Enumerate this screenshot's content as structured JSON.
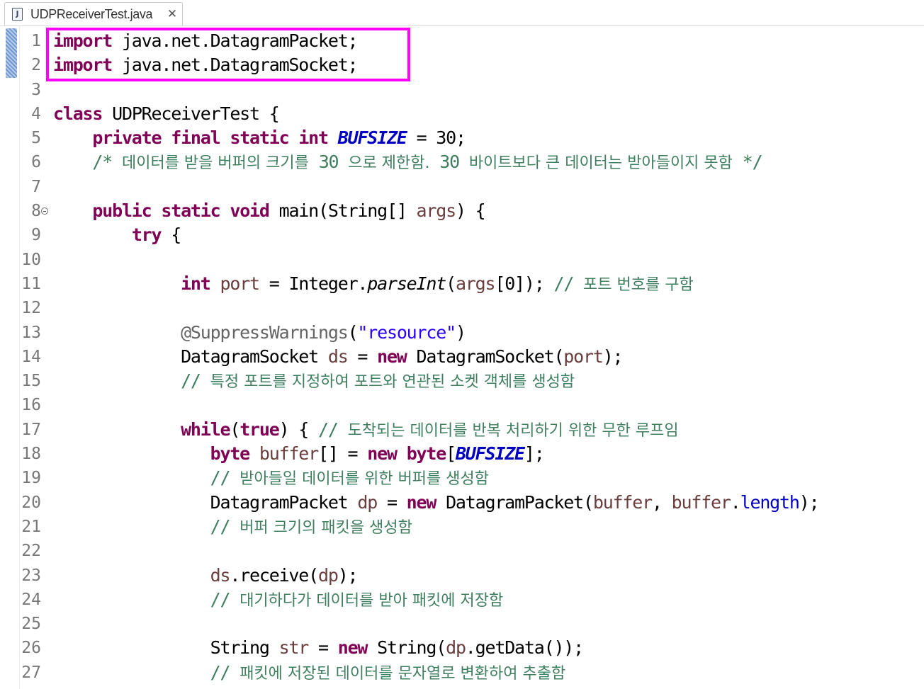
{
  "tab": {
    "filename": "UDPReceiverTest.java",
    "file_icon": "java-file-icon",
    "file_icon_glyph": "J",
    "close_glyph": "✕",
    "close_icon": "close-icon"
  },
  "colors": {
    "keyword": "#7f0055",
    "comment": "#3f7f5f",
    "constant": "#0000c0",
    "string": "#2a00ff",
    "annotation": "#646464",
    "local_variable": "#6a3e3e",
    "highlight_box": "#ff00ff"
  },
  "lines": [
    {
      "num": "1",
      "segments": [
        {
          "text": "import",
          "cls": "kw"
        },
        {
          "text": " java.net.DatagramPacket;"
        }
      ]
    },
    {
      "num": "2",
      "segments": [
        {
          "text": "import",
          "cls": "kw"
        },
        {
          "text": " java.net.DatagramSocket;"
        }
      ]
    },
    {
      "num": "3",
      "segments": []
    },
    {
      "num": "4",
      "segments": [
        {
          "text": "class",
          "cls": "kw"
        },
        {
          "text": " UDPReceiverTest {"
        }
      ]
    },
    {
      "num": "5",
      "segments": [
        {
          "text": "    "
        },
        {
          "text": "private",
          "cls": "kw"
        },
        {
          "text": " "
        },
        {
          "text": "final",
          "cls": "kw"
        },
        {
          "text": " "
        },
        {
          "text": "static",
          "cls": "kw"
        },
        {
          "text": " "
        },
        {
          "text": "int",
          "cls": "kw"
        },
        {
          "text": " "
        },
        {
          "text": "BUFSIZE",
          "cls": "const"
        },
        {
          "text": " = 30;"
        }
      ]
    },
    {
      "num": "6",
      "segments": [
        {
          "text": "    "
        },
        {
          "text": "/* ",
          "cls": "cm"
        },
        {
          "text": "데이터를 받을 버퍼의 크기를",
          "cls": "cm-k"
        },
        {
          "text": " 30 ",
          "cls": "cm"
        },
        {
          "text": "으로 제한함.",
          "cls": "cm-k"
        },
        {
          "text": " 30 ",
          "cls": "cm"
        },
        {
          "text": "바이트보다 큰 데이터는 받아들이지 못함",
          "cls": "cm-k"
        },
        {
          "text": " */",
          "cls": "cm"
        }
      ]
    },
    {
      "num": "7",
      "segments": []
    },
    {
      "num": "8",
      "fold": true,
      "segments": [
        {
          "text": "    "
        },
        {
          "text": "public",
          "cls": "kw"
        },
        {
          "text": " "
        },
        {
          "text": "static",
          "cls": "kw"
        },
        {
          "text": " "
        },
        {
          "text": "void",
          "cls": "kw"
        },
        {
          "text": " main(String[] "
        },
        {
          "text": "args",
          "cls": "var"
        },
        {
          "text": ") {"
        }
      ]
    },
    {
      "num": "9",
      "segments": [
        {
          "text": "        "
        },
        {
          "text": "try",
          "cls": "kw"
        },
        {
          "text": " {"
        }
      ]
    },
    {
      "num": "10",
      "segments": []
    },
    {
      "num": "11",
      "segments": [
        {
          "text": "             "
        },
        {
          "text": "int",
          "cls": "kw"
        },
        {
          "text": " "
        },
        {
          "text": "port",
          "cls": "var"
        },
        {
          "text": " = Integer."
        },
        {
          "text": "parseInt",
          "cls": "it"
        },
        {
          "text": "("
        },
        {
          "text": "args",
          "cls": "var"
        },
        {
          "text": "[0]); "
        },
        {
          "text": "// ",
          "cls": "cm"
        },
        {
          "text": "포트 번호를 구함",
          "cls": "cm-k"
        }
      ]
    },
    {
      "num": "12",
      "segments": []
    },
    {
      "num": "13",
      "segments": [
        {
          "text": "             "
        },
        {
          "text": "@SuppressWarnings",
          "cls": "ann"
        },
        {
          "text": "("
        },
        {
          "text": "\"resource\"",
          "cls": "str"
        },
        {
          "text": ")"
        }
      ]
    },
    {
      "num": "14",
      "segments": [
        {
          "text": "             DatagramSocket "
        },
        {
          "text": "ds",
          "cls": "var"
        },
        {
          "text": " = "
        },
        {
          "text": "new",
          "cls": "kw"
        },
        {
          "text": " DatagramSocket("
        },
        {
          "text": "port",
          "cls": "var"
        },
        {
          "text": ");"
        }
      ]
    },
    {
      "num": "15",
      "segments": [
        {
          "text": "             "
        },
        {
          "text": "// ",
          "cls": "cm"
        },
        {
          "text": "특정 포트를 지정하여 포트와 연관된 소켓 객체를 생성함",
          "cls": "cm-k"
        }
      ]
    },
    {
      "num": "16",
      "segments": []
    },
    {
      "num": "17",
      "segments": [
        {
          "text": "             "
        },
        {
          "text": "while",
          "cls": "kw"
        },
        {
          "text": "("
        },
        {
          "text": "true",
          "cls": "kw"
        },
        {
          "text": ") { "
        },
        {
          "text": "// ",
          "cls": "cm"
        },
        {
          "text": "도착되는 데이터를 반복 처리하기 위한 무한 루프임",
          "cls": "cm-k"
        }
      ]
    },
    {
      "num": "18",
      "segments": [
        {
          "text": "                "
        },
        {
          "text": "byte",
          "cls": "kw"
        },
        {
          "text": " "
        },
        {
          "text": "buffer",
          "cls": "var"
        },
        {
          "text": "[] = "
        },
        {
          "text": "new",
          "cls": "kw"
        },
        {
          "text": " "
        },
        {
          "text": "byte",
          "cls": "kw"
        },
        {
          "text": "["
        },
        {
          "text": "BUFSIZE",
          "cls": "const"
        },
        {
          "text": "];"
        }
      ]
    },
    {
      "num": "19",
      "segments": [
        {
          "text": "                "
        },
        {
          "text": "// ",
          "cls": "cm"
        },
        {
          "text": "받아들일 데이터를 위한 버퍼를 생성함",
          "cls": "cm-k"
        }
      ]
    },
    {
      "num": "20",
      "segments": [
        {
          "text": "                DatagramPacket "
        },
        {
          "text": "dp",
          "cls": "var"
        },
        {
          "text": " = "
        },
        {
          "text": "new",
          "cls": "kw"
        },
        {
          "text": " DatagramPacket("
        },
        {
          "text": "buffer",
          "cls": "var"
        },
        {
          "text": ", "
        },
        {
          "text": "buffer",
          "cls": "var"
        },
        {
          "text": "."
        },
        {
          "text": "length",
          "cls": "fld"
        },
        {
          "text": ");"
        }
      ]
    },
    {
      "num": "21",
      "segments": [
        {
          "text": "                "
        },
        {
          "text": "// ",
          "cls": "cm"
        },
        {
          "text": "버퍼 크기의 패킷을 생성함",
          "cls": "cm-k"
        }
      ]
    },
    {
      "num": "22",
      "segments": []
    },
    {
      "num": "23",
      "segments": [
        {
          "text": "                "
        },
        {
          "text": "ds",
          "cls": "var"
        },
        {
          "text": ".receive("
        },
        {
          "text": "dp",
          "cls": "var"
        },
        {
          "text": ");"
        }
      ]
    },
    {
      "num": "24",
      "segments": [
        {
          "text": "                "
        },
        {
          "text": "// ",
          "cls": "cm"
        },
        {
          "text": "대기하다가 데이터를 받아 패킷에 저장함",
          "cls": "cm-k"
        }
      ]
    },
    {
      "num": "25",
      "segments": []
    },
    {
      "num": "26",
      "segments": [
        {
          "text": "                String "
        },
        {
          "text": "str",
          "cls": "var"
        },
        {
          "text": " = "
        },
        {
          "text": "new",
          "cls": "kw"
        },
        {
          "text": " String("
        },
        {
          "text": "dp",
          "cls": "var"
        },
        {
          "text": ".getData());"
        }
      ]
    },
    {
      "num": "27",
      "segments": [
        {
          "text": "                "
        },
        {
          "text": "// ",
          "cls": "cm"
        },
        {
          "text": "패킷에 저장된 데이터를 문자열로 변환하여 추출함",
          "cls": "cm-k"
        }
      ]
    }
  ]
}
